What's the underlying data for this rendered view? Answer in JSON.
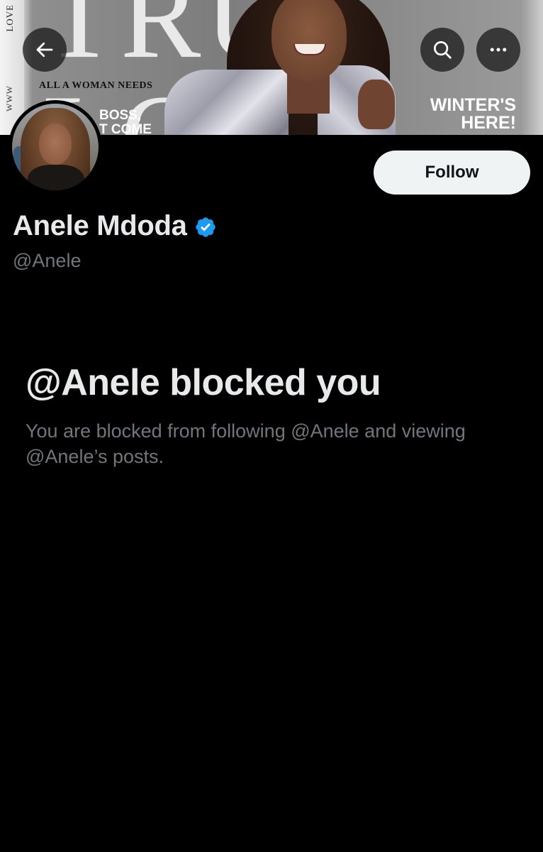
{
  "banner": {
    "masthead": "TRUE LOVE",
    "tagline": "ALL A WOMAN NEEDS",
    "left_headline_line1": "BOSS,",
    "left_headline_line2": "T COME",
    "right_headline_line1": "WINTER'S",
    "right_headline_line2": "HERE!",
    "spine_top": "LOVE",
    "spine_bottom": "WWW"
  },
  "toolbar": {
    "back_icon": "arrow-left-icon",
    "search_icon": "search-icon",
    "more_icon": "more-horizontal-icon"
  },
  "profile": {
    "follow_label": "Follow",
    "display_name": "Anele Mdoda",
    "handle": "@Anele",
    "verified_icon": "verified-badge-icon",
    "verified_color": "#1d9bf0"
  },
  "blocked": {
    "title": "@Anele blocked you",
    "description": "You are blocked from following @Anele and viewing @Anele’s posts."
  },
  "colors": {
    "background": "#000000",
    "primary_text": "#e7e9ea",
    "secondary_text": "#71767b",
    "follow_button_bg": "#eff3f4"
  }
}
